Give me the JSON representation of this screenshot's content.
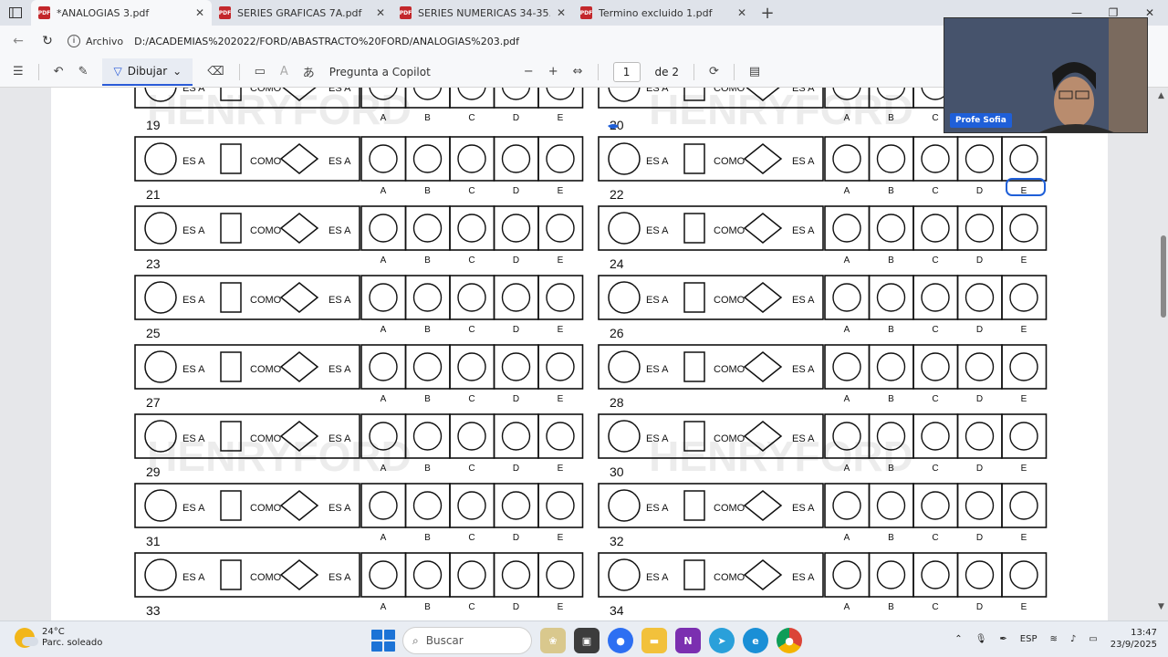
{
  "tabs": [
    {
      "title": "*ANALOGIAS 3.pdf",
      "active": true
    },
    {
      "title": "SERIES GRAFICAS 7A.pdf",
      "active": false
    },
    {
      "title": "SERIES NUMERICAS 34-35.pdf",
      "active": false
    },
    {
      "title": "Termino excluido 1.pdf",
      "active": false
    }
  ],
  "address": {
    "label": "Archivo",
    "url": "D:/ACADEMIAS%202022/FORD/ABASTRACTO%20FORD/ANALOGIAS%203.pdf"
  },
  "toolbar": {
    "draw_label": "Dibujar",
    "copilot_label": "Pregunta a Copilot",
    "page_value": "1",
    "page_total": "de 2"
  },
  "pdf": {
    "watermark": "HENRYFORD",
    "phrase_es_a": "ES A",
    "phrase_como": "COMO",
    "options": [
      "A",
      "B",
      "C",
      "D",
      "E"
    ],
    "problem_numbers": [
      "19",
      "20",
      "21",
      "22",
      "23",
      "24",
      "25",
      "26",
      "27",
      "28",
      "29",
      "30",
      "31",
      "32",
      "33",
      "34"
    ]
  },
  "webcam": {
    "name": "Profe Sofia"
  },
  "taskbar": {
    "temperature": "24°C",
    "weather": "Parc. soleado",
    "search_placeholder": "Buscar",
    "language": "ESP",
    "time": "13:47",
    "date": "23/9/2025"
  },
  "colors": {
    "accent": "#2a5bd7",
    "pdf_icon": "#c3272b",
    "annotation": "#1f5fd8"
  }
}
